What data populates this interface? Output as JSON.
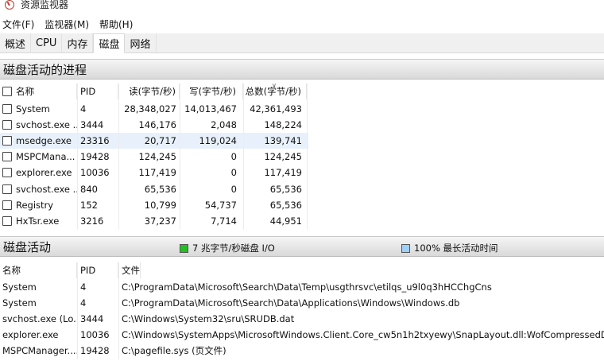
{
  "window": {
    "title": "资源监视器"
  },
  "menu": [
    "文件(F)",
    "监视器(M)",
    "帮助(H)"
  ],
  "tabs": [
    {
      "label": "概述",
      "active": false
    },
    {
      "label": "CPU",
      "active": false
    },
    {
      "label": "内存",
      "active": false
    },
    {
      "label": "磁盘",
      "active": true
    },
    {
      "label": "网络",
      "active": false
    }
  ],
  "disk_processes": {
    "title": "磁盘活动的进程",
    "columns": {
      "name": "名称",
      "pid": "PID",
      "read": "读(字节/秒)",
      "write": "写(字节/秒)",
      "total": "总数(字节/秒)"
    },
    "rows": [
      {
        "name": "System",
        "pid": "4",
        "read": "28,348,027",
        "write": "14,013,467",
        "total": "42,361,493"
      },
      {
        "name": "svchost.exe ...",
        "pid": "3444",
        "read": "146,176",
        "write": "2,048",
        "total": "148,224"
      },
      {
        "name": "msedge.exe",
        "pid": "23316",
        "read": "20,717",
        "write": "119,024",
        "total": "139,741"
      },
      {
        "name": "MSPCMana...",
        "pid": "19428",
        "read": "124,245",
        "write": "0",
        "total": "124,245"
      },
      {
        "name": "explorer.exe",
        "pid": "10036",
        "read": "117,419",
        "write": "0",
        "total": "117,419"
      },
      {
        "name": "svchost.exe ...",
        "pid": "840",
        "read": "65,536",
        "write": "0",
        "total": "65,536"
      },
      {
        "name": "Registry",
        "pid": "152",
        "read": "10,799",
        "write": "54,737",
        "total": "65,536"
      },
      {
        "name": "HxTsr.exe",
        "pid": "3216",
        "read": "37,237",
        "write": "7,714",
        "total": "44,951"
      }
    ]
  },
  "disk_activity": {
    "title": "磁盘活动",
    "io_legend": "7 兆字节/秒磁盘 I/O",
    "io_color": "#22c022",
    "time_legend": "100% 最长活动时间",
    "time_color": "#9fd0f5",
    "columns": {
      "name": "名称",
      "pid": "PID",
      "file": "文件"
    },
    "rows": [
      {
        "name": "System",
        "pid": "4",
        "file": "C:\\ProgramData\\Microsoft\\Search\\Data\\Temp\\usgthrsvc\\etilqs_u9l0q3hHCChgCns"
      },
      {
        "name": "System",
        "pid": "4",
        "file": "C:\\ProgramData\\Microsoft\\Search\\Data\\Applications\\Windows\\Windows.db"
      },
      {
        "name": "svchost.exe (Lo...",
        "pid": "3444",
        "file": "C:\\Windows\\System32\\sru\\SRUDB.dat"
      },
      {
        "name": "explorer.exe",
        "pid": "10036",
        "file": "C:\\Windows\\SystemApps\\MicrosoftWindows.Client.Core_cw5n1h2txyewy\\SnapLayout.dll:WofCompressedData"
      },
      {
        "name": "MSPCManager....",
        "pid": "19428",
        "file": "C:\\pagefile.sys (页文件)"
      }
    ]
  }
}
